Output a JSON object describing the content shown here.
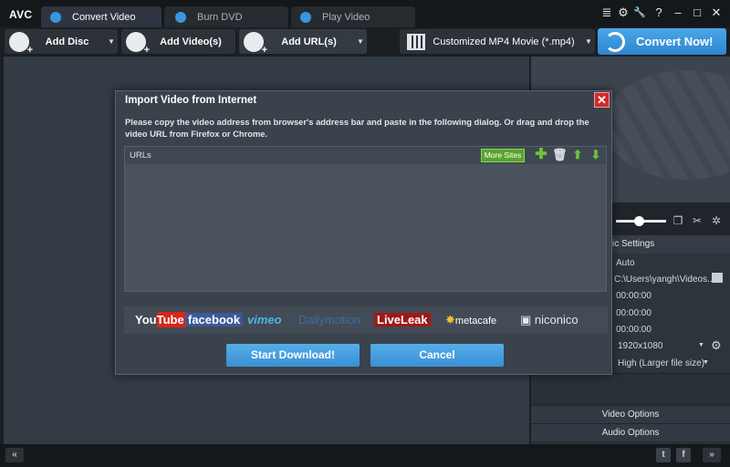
{
  "app": {
    "logo": "AVC"
  },
  "tabs": [
    {
      "label": "Convert Video",
      "icon": "convert-icon"
    },
    {
      "label": "Burn DVD",
      "icon": "disc-icon"
    },
    {
      "label": "Play Video",
      "icon": "play-icon"
    }
  ],
  "window_controls": {
    "menu": "≣",
    "settings": "⚙",
    "tools": "🔧",
    "help": "?",
    "minimize": "–",
    "maximize": "□",
    "close": "✕"
  },
  "toolbar": {
    "add_disc": "Add Disc",
    "add_videos": "Add Video(s)",
    "add_urls": "Add URL(s)",
    "format": "Customized MP4 Movie (*.mp4)",
    "convert_now": "Convert Now!"
  },
  "settings": {
    "basic_settings": "sic Settings",
    "rows": [
      {
        "value": "Auto"
      },
      {
        "value": "C:\\Users\\yangh\\Videos..."
      },
      {
        "value": "00:00:00"
      },
      {
        "value": "00:00:00"
      },
      {
        "value": "00:00:00"
      },
      {
        "value": "1920x1080"
      },
      {
        "value": "High (Larger file size)"
      }
    ],
    "video_options": "Video Options",
    "audio_options": "Audio Options"
  },
  "statusbar": {
    "collapse": "«",
    "expand": "»",
    "twitter": "t",
    "facebook": "f"
  },
  "dialog": {
    "title": "Import Video from Internet",
    "close": "✕",
    "instructions": "Please copy the video address from browser's address bar and paste in the following dialog. Or drag and drop the video URL from Firefox or Chrome.",
    "urls_label": "URLs",
    "more_sites": "More Sites",
    "sites": [
      "YouTube",
      "facebook",
      "vimeo",
      "Dailymotion",
      "LiveLeak",
      "metacafe",
      "niconico"
    ],
    "start_download": "Start Download!",
    "cancel": "Cancel"
  },
  "colors": {
    "accent": "#3a8fd4",
    "green": "#58a52c",
    "close_red": "#d42a2a"
  }
}
